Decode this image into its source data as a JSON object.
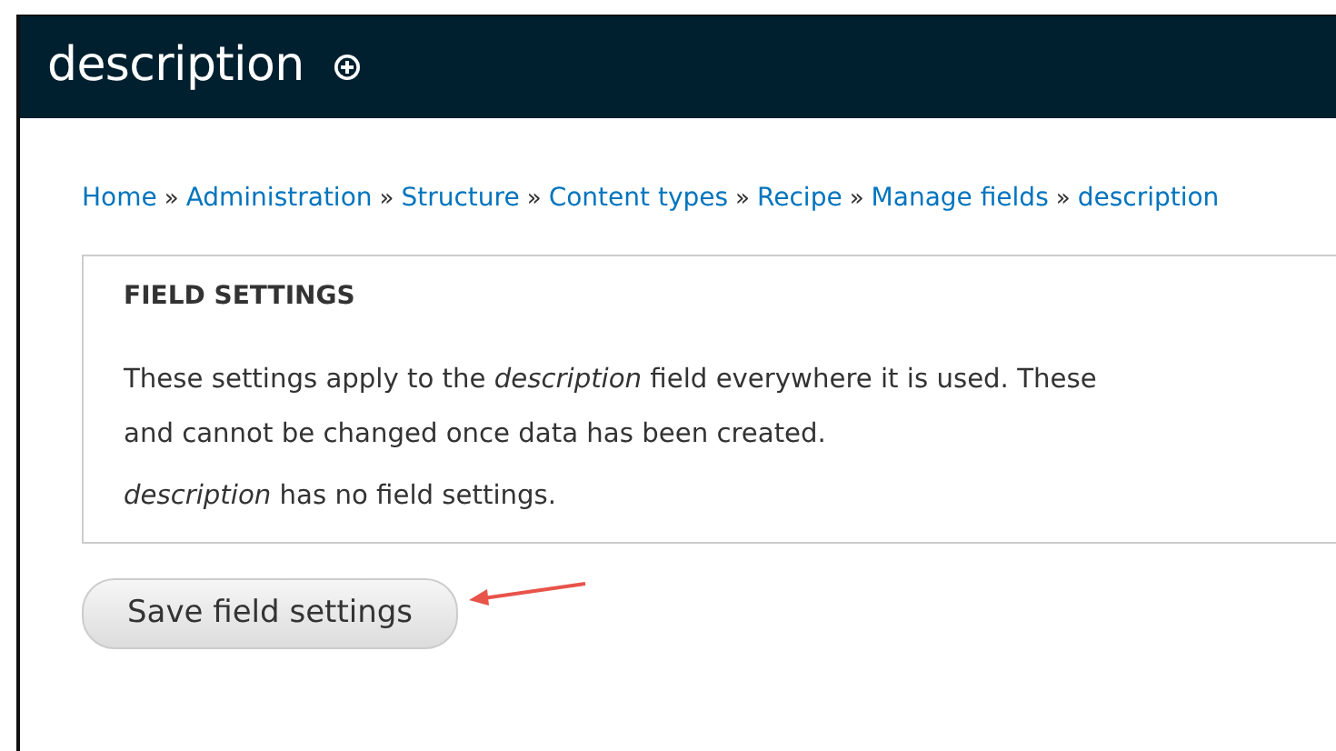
{
  "page_title": "description",
  "breadcrumb": [
    "Home",
    "Administration",
    "Structure",
    "Content types",
    "Recipe",
    "Manage fields",
    "description"
  ],
  "breadcrumb_separator": "»",
  "fieldset": {
    "legend": "FIELD SETTINGS",
    "description_lines": [
      "These settings apply to the *description* field everywhere it is used. These",
      "and cannot be changed once data has been created."
    ],
    "note": "*description* has no field settings."
  },
  "buttons": [
    "Save field settings"
  ]
}
